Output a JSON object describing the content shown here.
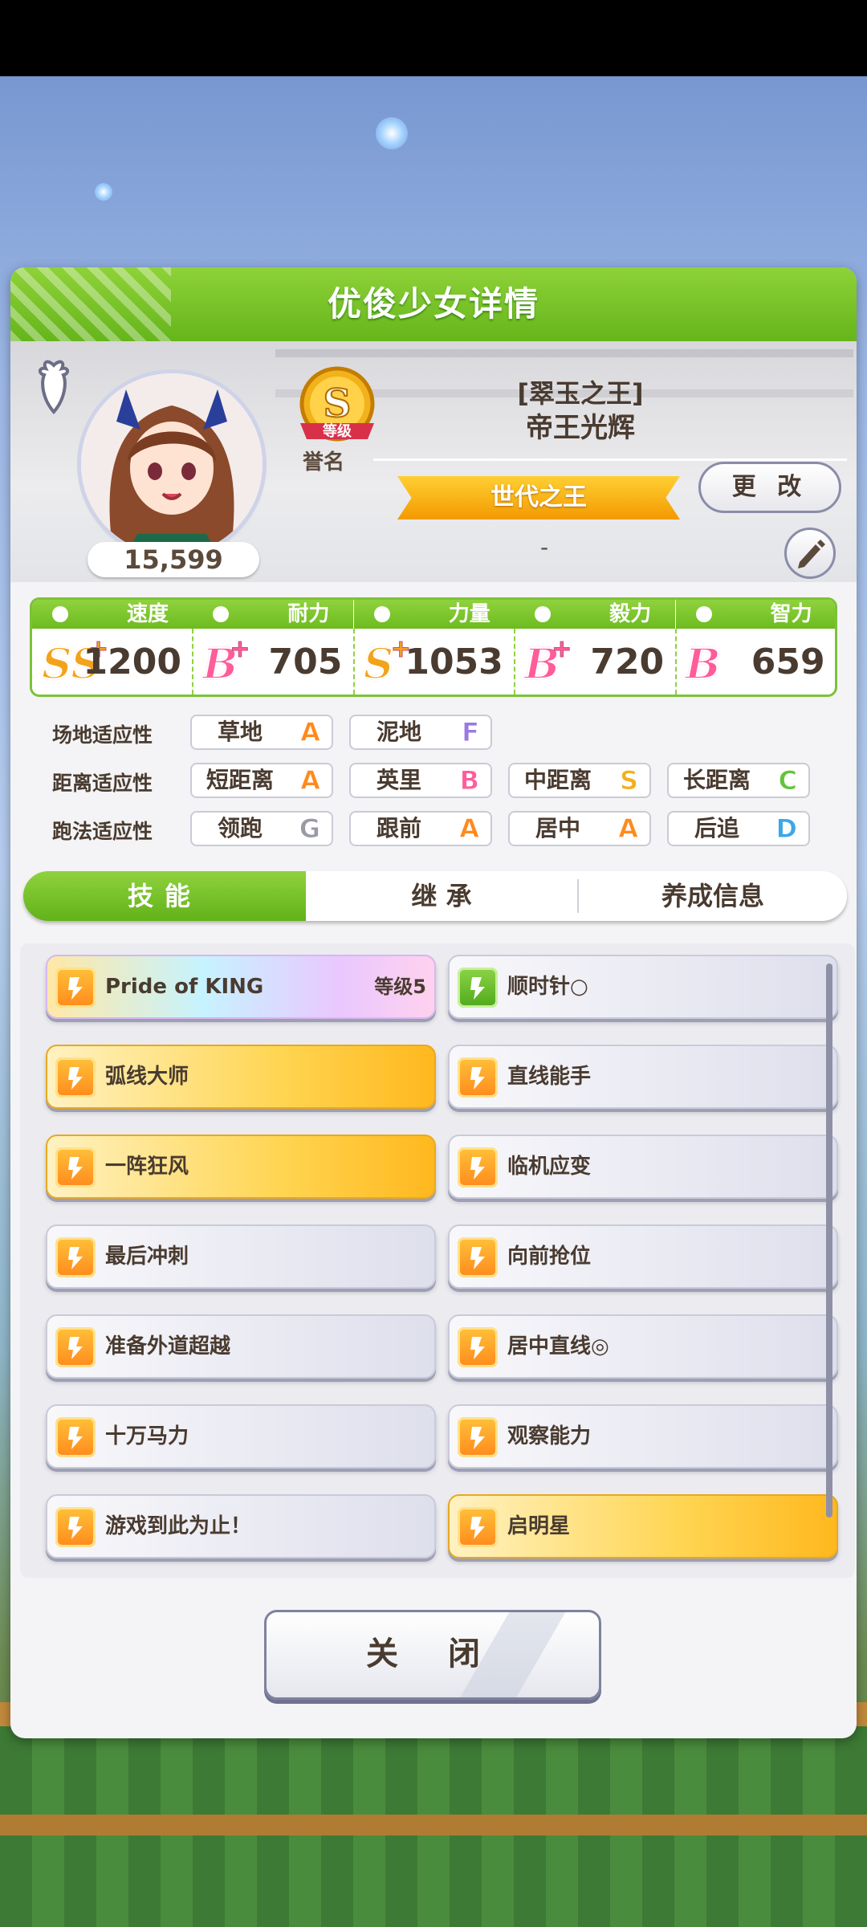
{
  "window": {
    "title": "优俊少女详情"
  },
  "profile": {
    "score": "15,599",
    "rank_caption": "誉名",
    "rank_letter": "S",
    "rank_sub": "等级",
    "epithet": "[翠玉之王]",
    "name": "帝王光辉",
    "title_ribbon": "世代之王",
    "change_label": "更 改",
    "subtitle": "-"
  },
  "stats": [
    {
      "label": "速度",
      "grade": "SS",
      "plus": "+",
      "value": "1200",
      "color": "#f2a31c",
      "icon": "shoe-icon"
    },
    {
      "label": "耐力",
      "grade": "B",
      "plus": "+",
      "value": "705",
      "color": "#ff5c9a",
      "icon": "heart-icon"
    },
    {
      "label": "力量",
      "grade": "S",
      "plus": "+",
      "value": "1053",
      "color": "#f2a31c",
      "icon": "muscle-icon"
    },
    {
      "label": "毅力",
      "grade": "B",
      "plus": "+",
      "value": "720",
      "color": "#ff5c9a",
      "icon": "flame-icon"
    },
    {
      "label": "智力",
      "grade": "B",
      "plus": "",
      "value": "659",
      "color": "#ff5c9a",
      "icon": "grad-cap-icon"
    }
  ],
  "aptitudes": [
    {
      "label": "场地适应性",
      "items": [
        {
          "name": "草地",
          "grade": "A",
          "color": "#ff8a1c"
        },
        {
          "name": "泥地",
          "grade": "F",
          "color": "#9a7ae0"
        }
      ]
    },
    {
      "label": "距离适应性",
      "items": [
        {
          "name": "短距离",
          "grade": "A",
          "color": "#ff8a1c"
        },
        {
          "name": "英里",
          "grade": "B",
          "color": "#ff5c9a"
        },
        {
          "name": "中距离",
          "grade": "S",
          "color": "#f2b01c"
        },
        {
          "name": "长距离",
          "grade": "C",
          "color": "#62c43a"
        }
      ]
    },
    {
      "label": "跑法适应性",
      "items": [
        {
          "name": "领跑",
          "grade": "G",
          "color": "#9a9aa6"
        },
        {
          "name": "跟前",
          "grade": "A",
          "color": "#ff8a1c"
        },
        {
          "name": "居中",
          "grade": "A",
          "color": "#ff8a1c"
        },
        {
          "name": "后追",
          "grade": "D",
          "color": "#3aa8e8"
        }
      ]
    }
  ],
  "tabs": [
    {
      "label": "技能",
      "active": true
    },
    {
      "label": "继 承",
      "active": false
    },
    {
      "label": "养成信息",
      "active": false
    }
  ],
  "skills": [
    {
      "name": "Pride of KING",
      "level": "等级5",
      "style": "rainbow",
      "icon": "unique-skill-icon"
    },
    {
      "name": "顺时针○",
      "level": "",
      "style": "white",
      "icon": "green-card-icon"
    },
    {
      "name": "弧线大师",
      "level": "",
      "style": "gold",
      "icon": "runner-icon"
    },
    {
      "name": "直线能手",
      "level": "",
      "style": "white",
      "icon": "runner-icon"
    },
    {
      "name": "一阵狂风",
      "level": "",
      "style": "gold",
      "icon": "runner-icon"
    },
    {
      "name": "临机应变",
      "level": "",
      "style": "white",
      "icon": "arrows-icon"
    },
    {
      "name": "最后冲刺",
      "level": "",
      "style": "white",
      "icon": "runner-icon"
    },
    {
      "name": "向前抢位",
      "level": "",
      "style": "white",
      "icon": "runner-icon"
    },
    {
      "name": "准备外道超越",
      "level": "",
      "style": "white",
      "icon": "runner-icon"
    },
    {
      "name": "居中直线◎",
      "level": "",
      "style": "white",
      "icon": "runner-icon"
    },
    {
      "name": "十万马力",
      "level": "",
      "style": "white",
      "icon": "runner-icon"
    },
    {
      "name": "观察能力",
      "level": "",
      "style": "white",
      "icon": "megaphone-icon"
    },
    {
      "name": "游戏到此为止！",
      "level": "",
      "style": "white",
      "icon": "runner-icon"
    },
    {
      "name": "启明星",
      "level": "",
      "style": "gold",
      "icon": "runner-icon"
    }
  ],
  "close_label": "关 闭"
}
